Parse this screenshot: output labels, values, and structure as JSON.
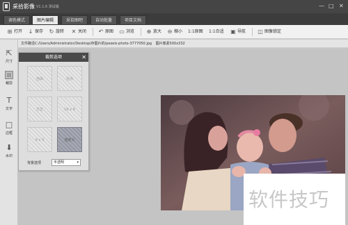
{
  "titlebar": {
    "app_name": "采拾影像",
    "version": "V1.1.6 测试版",
    "min": "—",
    "max": "□",
    "close": "✕"
  },
  "tabs": [
    {
      "label": "调色模式",
      "active": false
    },
    {
      "label": "图片编辑",
      "active": true
    },
    {
      "label": "采拾图吧",
      "active": false
    },
    {
      "label": "自动批量",
      "active": false
    },
    {
      "label": "项目文档",
      "active": false
    }
  ],
  "toolbar": {
    "open": "打开",
    "save": "保存",
    "rotate": "旋转",
    "close": "关闭",
    "original": "原图",
    "browse": "浏览",
    "zoom_in": "放大",
    "zoom_out": "缩小",
    "actual": "1:1原图",
    "fit": "1:1合适",
    "navigate": "导航",
    "lock": "图像锁定"
  },
  "pathbar": {
    "path": "文件路径C:/Users/Administrator/Desktop/存图片的/pexels-photo-3777050.jpg",
    "size": "图片像素500x332"
  },
  "leftbar": {
    "size": "尺寸",
    "crop": "裁剪",
    "text": "文字",
    "border": "边框",
    "watermark": "水印"
  },
  "panel": {
    "title": "裁剪选项",
    "close": "✕",
    "options": [
      "自由",
      "拉点",
      "方正",
      "16 x 9",
      "4 x 3",
      "自定义"
    ],
    "bg_label": "背景选项",
    "bg_value": "半透明"
  },
  "watermark": "软件技巧",
  "colors": {
    "titlebar": "#454545",
    "tab_active": "#e9e9e9",
    "canvas": "#c4c4c4",
    "panel_head": "#4a4a4a"
  }
}
